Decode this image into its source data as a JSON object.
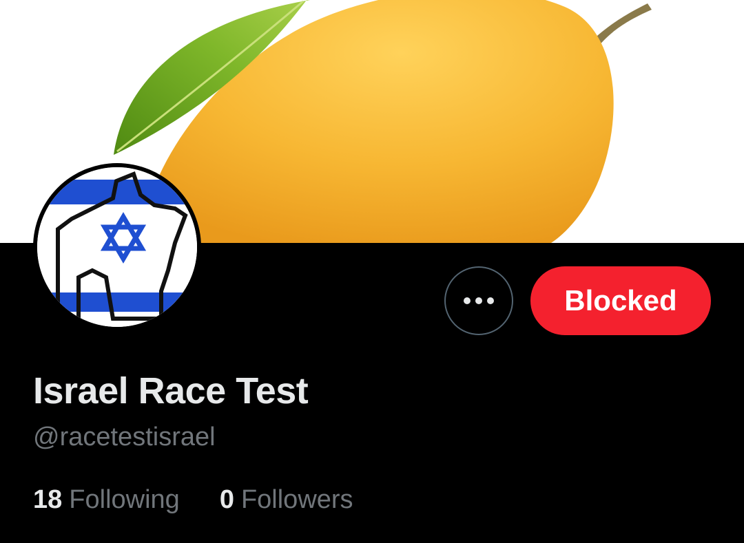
{
  "profile": {
    "display_name": "Israel Race Test",
    "handle": "@racetestisrael",
    "banner_image": "mango-icon",
    "avatar_image": "israel-flag-pixel-avatar-icon"
  },
  "actions": {
    "more_icon": "ellipsis-icon",
    "blocked_label": "Blocked"
  },
  "stats": {
    "following_count": "18",
    "following_label": "Following",
    "followers_count": "0",
    "followers_label": "Followers"
  },
  "colors": {
    "background": "#000000",
    "blocked_red": "#f4212e",
    "primary_text": "#e7e9ea",
    "secondary_text": "#71767b",
    "flag_blue": "#1f4fd1"
  }
}
